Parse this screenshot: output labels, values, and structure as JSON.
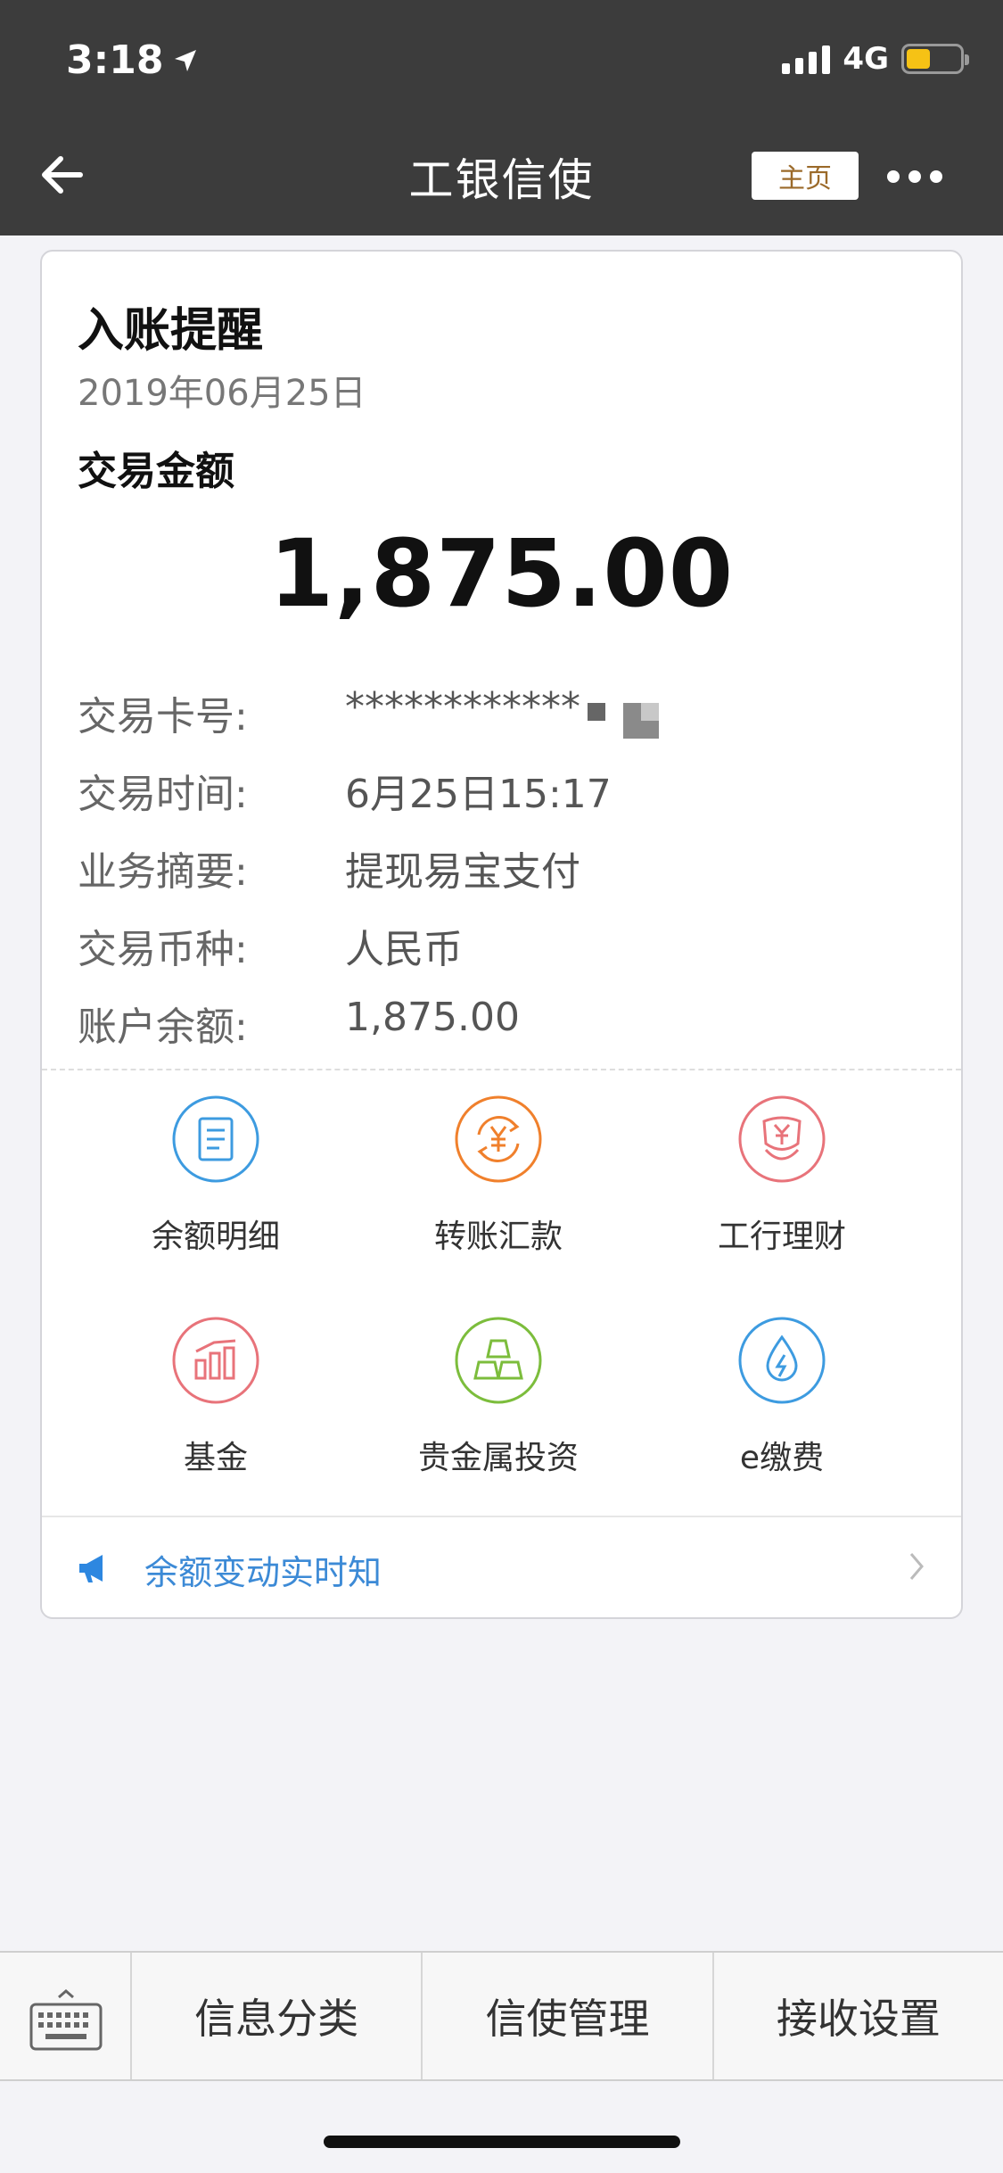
{
  "status_bar": {
    "time": "3:18",
    "network": "4G"
  },
  "nav": {
    "title": "工银信使",
    "home_button": "主页"
  },
  "card": {
    "title": "入账提醒",
    "date": "2019年06月25日",
    "amount_label": "交易金额",
    "amount": "1,875.00",
    "details": [
      {
        "label": "交易卡号:",
        "value": "************"
      },
      {
        "label": "交易时间:",
        "value": "6月25日15:17"
      },
      {
        "label": "业务摘要:",
        "value": "提现易宝支付"
      },
      {
        "label": "交易币种:",
        "value": "人民币"
      },
      {
        "label": "账户余额:",
        "value": "1,875.00"
      }
    ],
    "actions": [
      {
        "label": "余额明细",
        "icon": "document-icon",
        "color": "#3d9be0"
      },
      {
        "label": "转账汇款",
        "icon": "yuan-transfer-icon",
        "color": "#f0802c"
      },
      {
        "label": "工行理财",
        "icon": "yuan-flower-icon",
        "color": "#e8737a"
      },
      {
        "label": "基金",
        "icon": "bar-chart-icon",
        "color": "#e8737a"
      },
      {
        "label": "贵金属投资",
        "icon": "gold-bars-icon",
        "color": "#7cbd3c"
      },
      {
        "label": "e缴费",
        "icon": "drop-bolt-icon",
        "color": "#3d9be0"
      }
    ],
    "promo": {
      "text": "余额变动实时知",
      "icon": "megaphone-icon"
    }
  },
  "bottom_bar": {
    "items": [
      "信息分类",
      "信使管理",
      "接收设置"
    ]
  }
}
